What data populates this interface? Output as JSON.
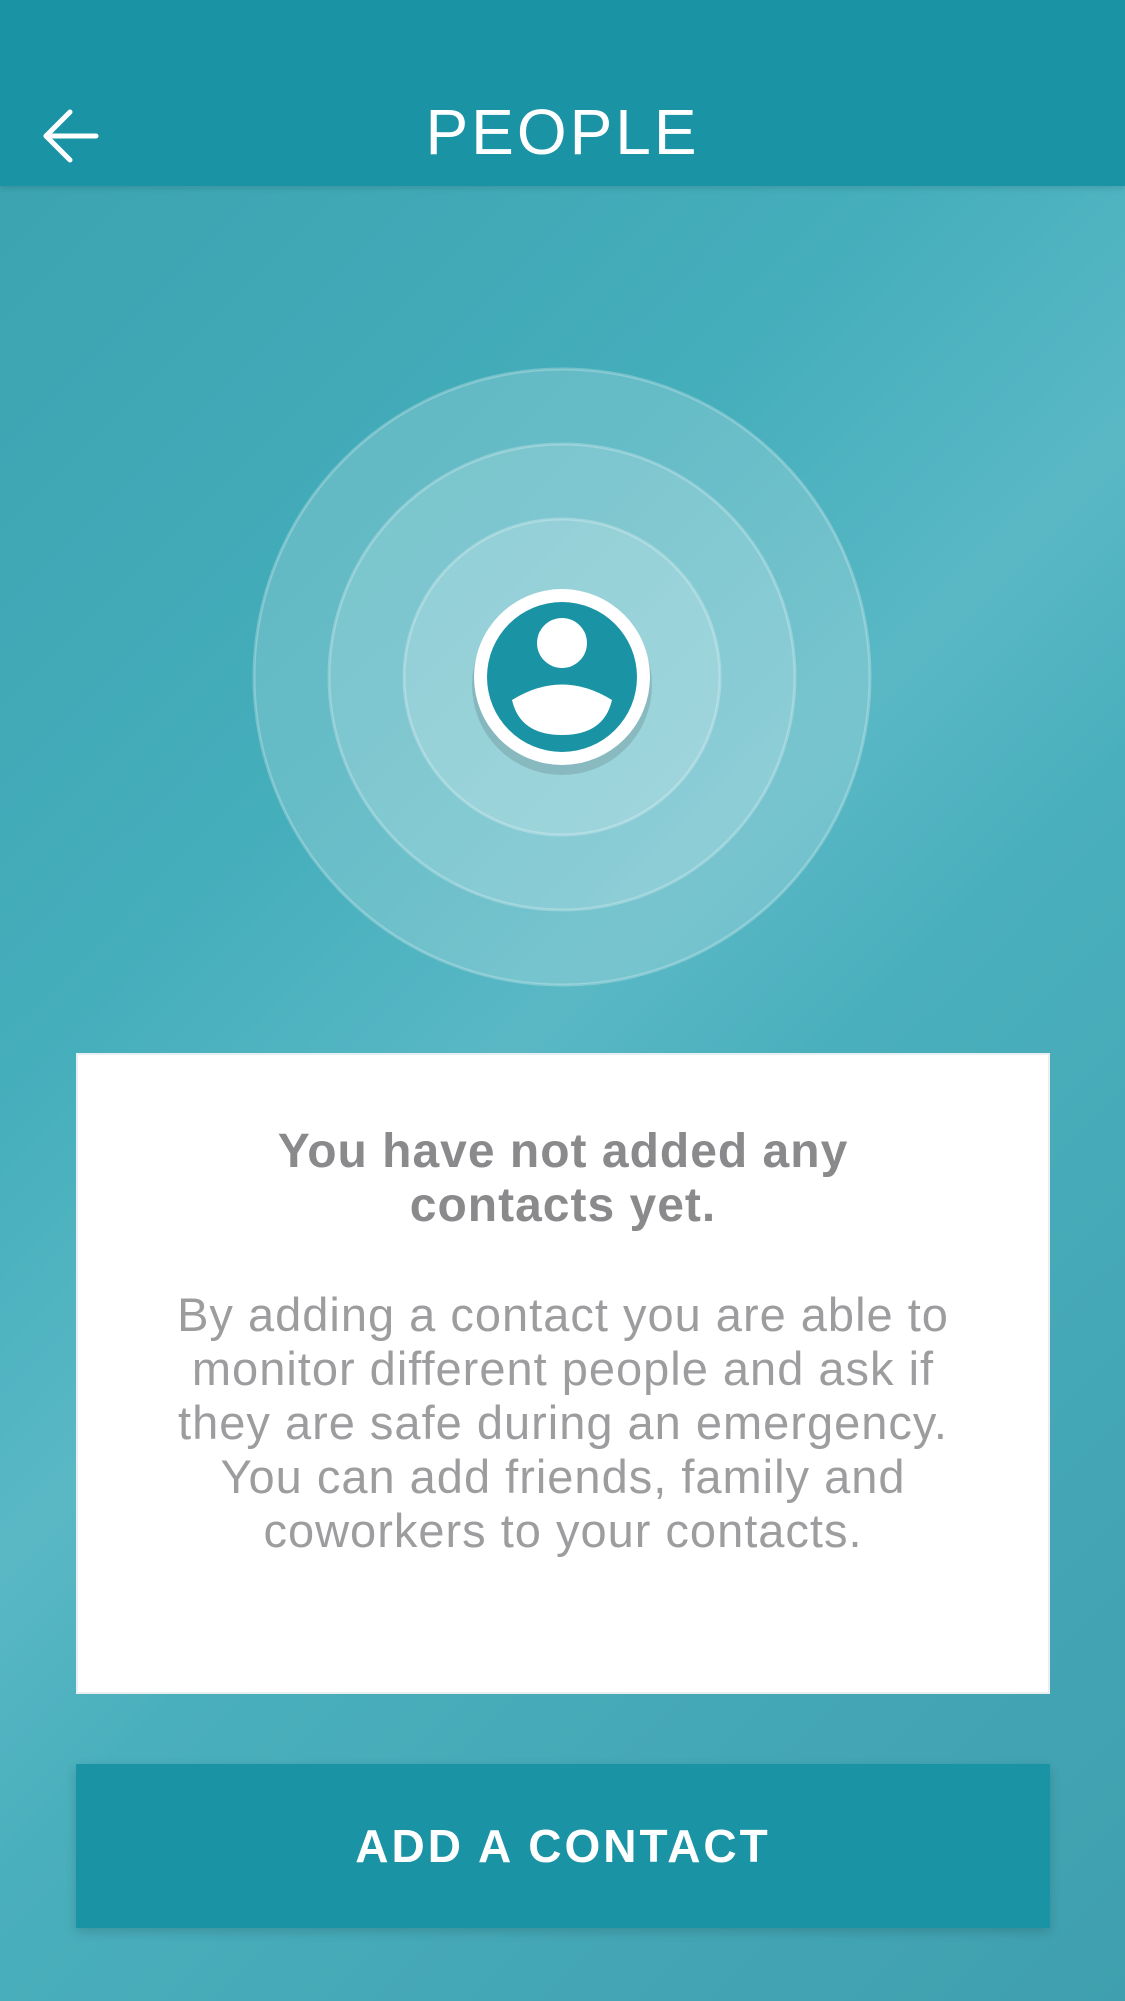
{
  "header": {
    "title": "PEOPLE",
    "back_icon": "arrow-left-icon"
  },
  "illustration": {
    "icon": "person-icon"
  },
  "empty_state": {
    "heading": "You have not added any contacts yet.",
    "body": "By adding a contact you are able to monitor different people and ask if they are safe during an emergency. You can add friends, family and coworkers to your contacts."
  },
  "actions": {
    "add_contact_label": "ADD A CONTACT"
  },
  "colors": {
    "primary": "#1a94a5",
    "background": "#45aebb",
    "card": "#ffffff",
    "heading_text": "#8a8a8d",
    "body_text": "#9d9da0"
  }
}
